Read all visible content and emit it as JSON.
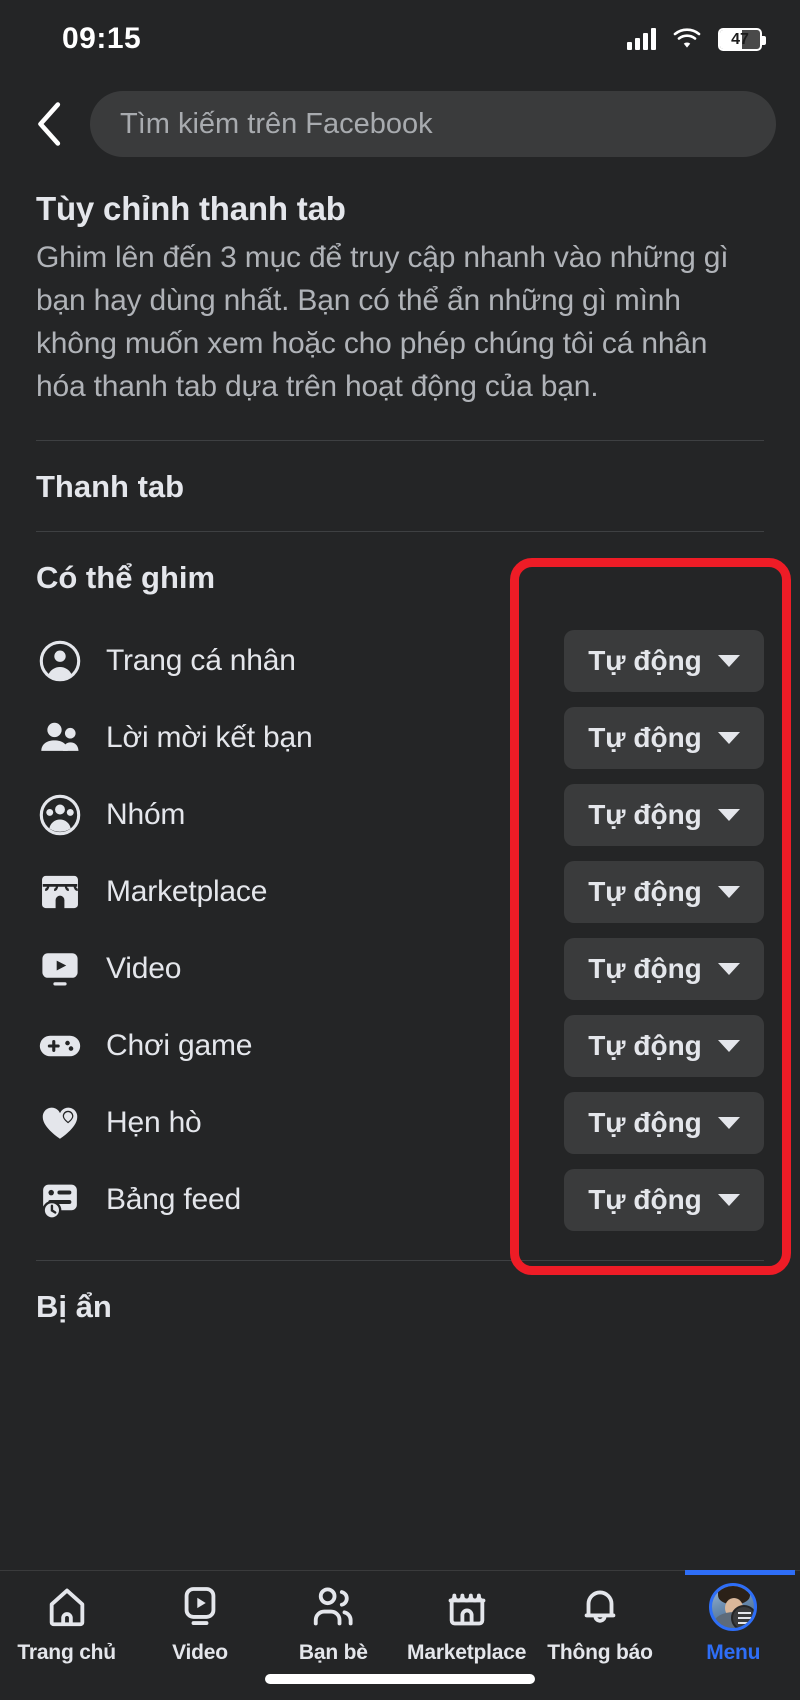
{
  "status_bar": {
    "time": "09:15",
    "battery_percent": "47",
    "signal_icon": "signal-bars-icon",
    "wifi_icon": "wifi-icon",
    "battery_icon": "battery-icon"
  },
  "header": {
    "back_icon": "back-chevron-icon",
    "search_placeholder": "Tìm kiếm trên Facebook",
    "search_value": ""
  },
  "intro": {
    "title": "Tùy chỉnh thanh tab",
    "description": "Ghim lên đến 3 mục để truy cập nhanh vào những gì bạn hay dùng nhất. Bạn có thể ẩn những gì mình không muốn xem hoặc cho phép chúng tôi cá nhân hóa thanh tab dựa trên hoạt động của bạn."
  },
  "sections": {
    "tab_bar_heading": "Thanh tab",
    "pinnable_heading": "Có thể ghim",
    "hidden_heading": "Bị ẩn"
  },
  "pinnable_items": [
    {
      "label": "Trang cá nhân",
      "icon": "profile-circle-icon",
      "state": "Tự động"
    },
    {
      "label": "Lời mời kết bạn",
      "icon": "friends-icon",
      "state": "Tự động"
    },
    {
      "label": "Nhóm",
      "icon": "groups-circle-icon",
      "state": "Tự động"
    },
    {
      "label": "Marketplace",
      "icon": "marketplace-shop-icon",
      "state": "Tự động"
    },
    {
      "label": "Video",
      "icon": "video-play-icon",
      "state": "Tự động"
    },
    {
      "label": "Chơi game",
      "icon": "gamepad-icon",
      "state": "Tự động"
    },
    {
      "label": "Hẹn hò",
      "icon": "heart-dating-icon",
      "state": "Tự động"
    },
    {
      "label": "Bảng feed",
      "icon": "feeds-clock-icon",
      "state": "Tự động"
    }
  ],
  "annotation": {
    "type": "rectangle-highlight",
    "color": "#ee1c26"
  },
  "bottom_nav": [
    {
      "label": "Trang chủ",
      "icon": "home-icon",
      "active": false
    },
    {
      "label": "Video",
      "icon": "video-icon",
      "active": false
    },
    {
      "label": "Bạn bè",
      "icon": "friends-icon",
      "active": false
    },
    {
      "label": "Marketplace",
      "icon": "marketplace-icon",
      "active": false
    },
    {
      "label": "Thông báo",
      "icon": "bell-icon",
      "active": false
    },
    {
      "label": "Menu",
      "icon": "avatar-menu-icon",
      "active": true
    }
  ],
  "colors": {
    "background": "#242526",
    "surface": "#3a3b3c",
    "text_primary": "#e4e6eb",
    "text_secondary": "#b0b3b8",
    "accent_blue": "#2e6ef7",
    "annotation_red": "#ee1c26"
  }
}
